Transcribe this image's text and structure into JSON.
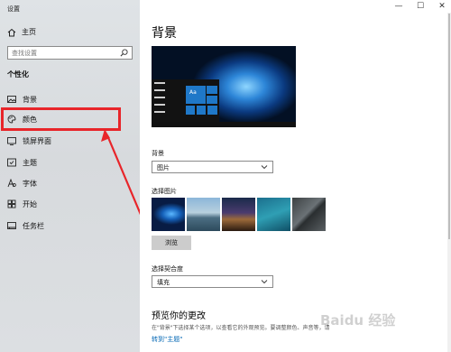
{
  "window": {
    "title": "设置"
  },
  "sidebar": {
    "home_label": "主页",
    "search_placeholder": "查找设置",
    "section_title": "个性化",
    "items": [
      {
        "label": "背景",
        "icon": "image-icon"
      },
      {
        "label": "颜色",
        "icon": "palette-icon"
      },
      {
        "label": "锁屏界面",
        "icon": "lock-screen-icon"
      },
      {
        "label": "主题",
        "icon": "theme-icon"
      },
      {
        "label": "字体",
        "icon": "font-icon"
      },
      {
        "label": "开始",
        "icon": "start-icon"
      },
      {
        "label": "任务栏",
        "icon": "taskbar-icon"
      }
    ],
    "highlight_color": "#e8252a"
  },
  "main": {
    "page_title": "背景",
    "preview_tile_label": "Aa",
    "background_label": "背景",
    "background_value": "图片",
    "choose_picture_label": "选择图片",
    "browse_button": "浏览",
    "fit_label": "选择契合度",
    "fit_value": "填充",
    "preview_title": "预览你的更改",
    "preview_desc": "在\"背景\"下选择某个选项，以查看它的外观预览。要调整颜色、声音等，请",
    "link_text": "转到\"主题\""
  },
  "window_controls": {
    "minimize": "—",
    "maximize": "☐",
    "close": "✕"
  },
  "watermark": "Baidu 经验",
  "colors": {
    "accent": "#0066b4",
    "tile": "#1f78c8"
  }
}
